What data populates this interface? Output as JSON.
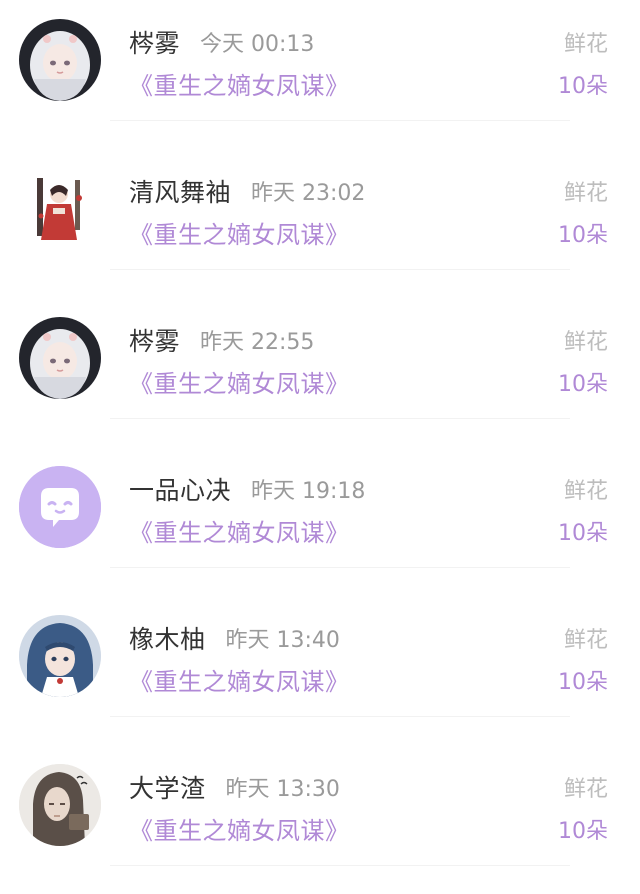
{
  "colors": {
    "username": "#333333",
    "time": "#9a9a9a",
    "book_title": "#b089d6",
    "gift_type": "#bdbdbd",
    "gift_count": "#b089d6",
    "default_avatar_bg": "#c9b3f2"
  },
  "gifts": [
    {
      "avatar": "anime-girl-white-hair-avatar",
      "username": "梣雾",
      "time": "今天 00:13",
      "book": "《重生之嫡女凤谋》",
      "gift_type": "鲜花",
      "gift_count": "10朵"
    },
    {
      "avatar": "illustration-red-dress-avatar",
      "username": "清风舞袖",
      "time": "昨天 23:02",
      "book": "《重生之嫡女凤谋》",
      "gift_type": "鲜花",
      "gift_count": "10朵"
    },
    {
      "avatar": "anime-girl-white-hair-avatar",
      "username": "梣雾",
      "time": "昨天 22:55",
      "book": "《重生之嫡女凤谋》",
      "gift_type": "鲜花",
      "gift_count": "10朵"
    },
    {
      "avatar": "default-chat-bubble-avatar",
      "username": "一品心决",
      "time": "昨天 19:18",
      "book": "《重生之嫡女凤谋》",
      "gift_type": "鲜花",
      "gift_count": "10朵"
    },
    {
      "avatar": "anime-girl-blue-hair-avatar",
      "username": "橡木柚",
      "time": "昨天 13:40",
      "book": "《重生之嫡女凤谋》",
      "gift_type": "鲜花",
      "gift_count": "10朵"
    },
    {
      "avatar": "hooded-man-avatar",
      "username": "大学渣",
      "time": "昨天 13:30",
      "book": "《重生之嫡女凤谋》",
      "gift_type": "鲜花",
      "gift_count": "10朵"
    }
  ]
}
